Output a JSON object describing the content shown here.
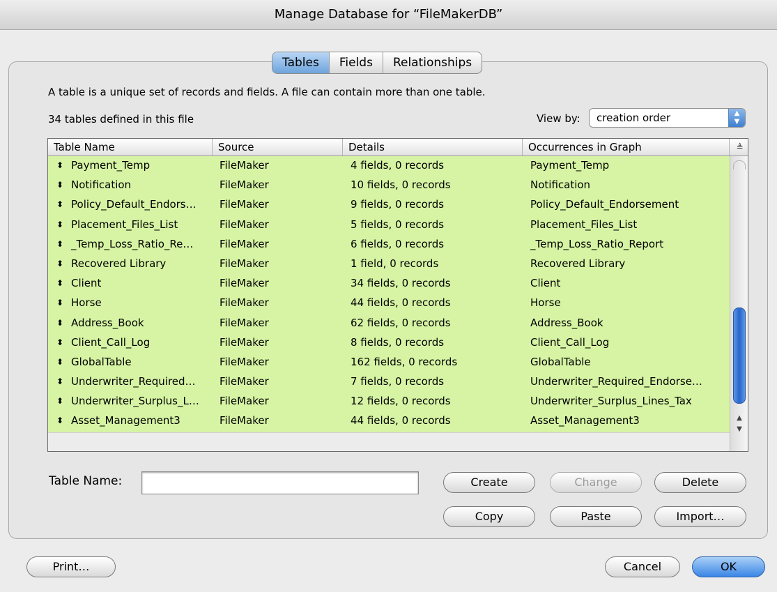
{
  "window": {
    "title": "Manage Database for “FileMakerDB”"
  },
  "tabs": [
    {
      "label": "Tables"
    },
    {
      "label": "Fields"
    },
    {
      "label": "Relationships"
    }
  ],
  "description": "A table is a unique set of records and fields. A file can contain more than one table.",
  "table_count_text": "34 tables defined in this file",
  "view_by": {
    "label": "View by:",
    "value": "creation order"
  },
  "columns": [
    "Table Name",
    "Source",
    "Details",
    "Occurrences in Graph"
  ],
  "rows": [
    {
      "name": "Payment_Temp",
      "source": "FileMaker",
      "details": "4 fields, 0 records",
      "occurrences": "Payment_Temp"
    },
    {
      "name": "Notification",
      "source": "FileMaker",
      "details": "10 fields, 0 records",
      "occurrences": "Notification"
    },
    {
      "name": "Policy_Default_Endors…",
      "source": "FileMaker",
      "details": "9 fields, 0 records",
      "occurrences": "Policy_Default_Endorsement"
    },
    {
      "name": "Placement_Files_List",
      "source": "FileMaker",
      "details": "5 fields, 0 records",
      "occurrences": "Placement_Files_List"
    },
    {
      "name": "_Temp_Loss_Ratio_Re…",
      "source": "FileMaker",
      "details": "6 fields, 0 records",
      "occurrences": "_Temp_Loss_Ratio_Report"
    },
    {
      "name": "Recovered Library",
      "source": "FileMaker",
      "details": "1 field, 0 records",
      "occurrences": "Recovered Library"
    },
    {
      "name": "Client",
      "source": "FileMaker",
      "details": "34 fields, 0 records",
      "occurrences": "Client"
    },
    {
      "name": "Horse",
      "source": "FileMaker",
      "details": "44 fields, 0 records",
      "occurrences": "Horse"
    },
    {
      "name": "Address_Book",
      "source": "FileMaker",
      "details": "62 fields, 0 records",
      "occurrences": "Address_Book"
    },
    {
      "name": "Client_Call_Log",
      "source": "FileMaker",
      "details": "8 fields, 0 records",
      "occurrences": "Client_Call_Log"
    },
    {
      "name": "GlobalTable",
      "source": "FileMaker",
      "details": "162 fields, 0 records",
      "occurrences": "GlobalTable"
    },
    {
      "name": "Underwriter_Required…",
      "source": "FileMaker",
      "details": "7 fields, 0 records",
      "occurrences": "Underwriter_Required_Endorse…"
    },
    {
      "name": "Underwriter_Surplus_L…",
      "source": "FileMaker",
      "details": "12 fields, 0 records",
      "occurrences": "Underwriter_Surplus_Lines_Tax"
    },
    {
      "name": "Asset_Management3",
      "source": "FileMaker",
      "details": "44 fields, 0 records",
      "occurrences": "Asset_Management3"
    }
  ],
  "table_name_field": {
    "label": "Table Name:",
    "value": ""
  },
  "buttons": {
    "create": "Create",
    "change": "Change",
    "delete": "Delete",
    "copy": "Copy",
    "paste": "Paste",
    "import": "Import…",
    "print": "Print…",
    "cancel": "Cancel",
    "ok": "OK"
  },
  "colors": {
    "row_background": "#d6f4a4",
    "accent": "#3a86e6"
  }
}
